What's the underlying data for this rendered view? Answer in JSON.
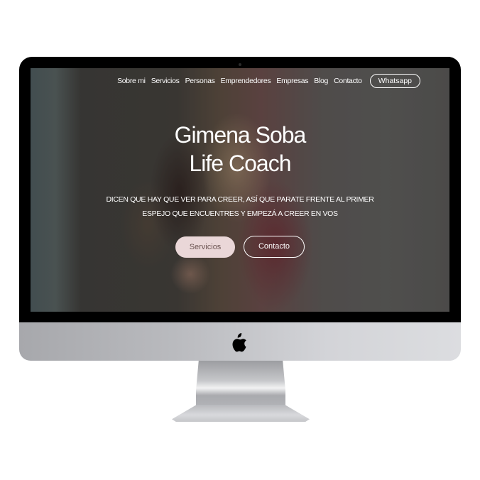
{
  "nav": {
    "links": [
      "Sobre mi",
      "Servicios",
      "Personas",
      "Emprendedores",
      "Empresas",
      "Blog",
      "Contacto"
    ],
    "cta_label": "Whatsapp"
  },
  "hero": {
    "title_line1": "Gimena Soba",
    "title_line2": "Life Coach",
    "subtitle": "DICEN QUE HAY QUE VER PARA CREER, ASÍ QUE PARATE FRENTE AL PRIMER ESPEJO QUE ENCUENTRES Y EMPEZÁ A CREER EN VOS",
    "primary_button": "Servicios",
    "secondary_button": "Contacto"
  },
  "device": {
    "logo_icon": "apple-logo-icon"
  },
  "colors": {
    "primary_button_bg": "#ead7d8",
    "primary_button_text": "#6c5552",
    "text": "#ffffff"
  }
}
